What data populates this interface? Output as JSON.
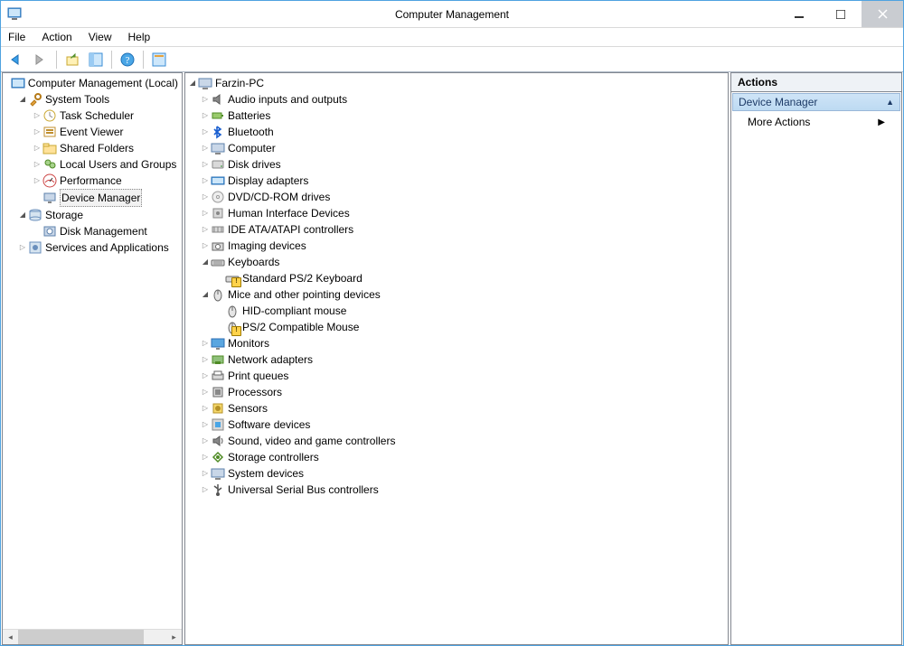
{
  "window": {
    "title": "Computer Management"
  },
  "menu": {
    "file": "File",
    "action": "Action",
    "view": "View",
    "help": "Help"
  },
  "left_tree": {
    "root": "Computer Management (Local)",
    "system_tools": "System Tools",
    "task_scheduler": "Task Scheduler",
    "event_viewer": "Event Viewer",
    "shared_folders": "Shared Folders",
    "local_users": "Local Users and Groups",
    "performance": "Performance",
    "device_manager": "Device Manager",
    "storage": "Storage",
    "disk_management": "Disk Management",
    "services_apps": "Services and Applications"
  },
  "device_tree": {
    "root": "Farzin-PC",
    "audio": "Audio inputs and outputs",
    "batteries": "Batteries",
    "bluetooth": "Bluetooth",
    "computer": "Computer",
    "disk": "Disk drives",
    "display": "Display adapters",
    "dvd": "DVD/CD-ROM drives",
    "hid": "Human Interface Devices",
    "ide": "IDE ATA/ATAPI controllers",
    "imaging": "Imaging devices",
    "keyboards": "Keyboards",
    "keyboard_std": "Standard PS/2 Keyboard",
    "mice": "Mice and other pointing devices",
    "mouse_hid": "HID-compliant mouse",
    "mouse_ps2": "PS/2 Compatible Mouse",
    "monitors": "Monitors",
    "network": "Network adapters",
    "print": "Print queues",
    "processors": "Processors",
    "sensors": "Sensors",
    "software": "Software devices",
    "sound": "Sound, video and game controllers",
    "storage_ctrl": "Storage controllers",
    "system": "System devices",
    "usb": "Universal Serial Bus controllers"
  },
  "actions": {
    "header": "Actions",
    "section": "Device Manager",
    "more": "More Actions"
  }
}
